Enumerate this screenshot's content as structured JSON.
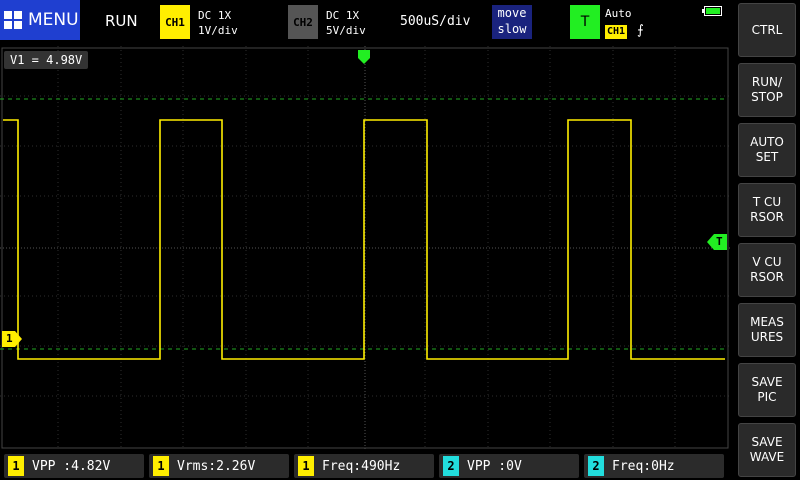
{
  "header": {
    "menu_label": "MENU",
    "run_state": "RUN",
    "ch1": {
      "label": "CH1",
      "coupling": "DC  1X",
      "scale": "1V/div"
    },
    "ch2": {
      "label": "CH2",
      "coupling": "DC  1X",
      "scale": "5V/div"
    },
    "timebase": "500uS/div",
    "move": {
      "line1": "move",
      "line2": "slow"
    },
    "trigger": {
      "label": "T",
      "mode": "Auto",
      "source": "CH1",
      "edge": "⨍"
    }
  },
  "readout": {
    "v1": "V1 = 4.98V"
  },
  "markers": {
    "ch1": "1",
    "trigger": "T"
  },
  "sidebar": {
    "buttons": [
      {
        "label": "CTRL"
      },
      {
        "label": "RUN/\nSTOP"
      },
      {
        "label": "AUTO\nSET"
      },
      {
        "label": "T CU\nRSOR"
      },
      {
        "label": "V CU\nRSOR"
      },
      {
        "label": "MEAS\nURES"
      },
      {
        "label": "SAVE\nPIC"
      },
      {
        "label": "SAVE\nWAVE"
      }
    ]
  },
  "measurements": [
    {
      "channel": "1",
      "text": "VPP :4.82V"
    },
    {
      "channel": "1",
      "text": "Vrms:2.26V"
    },
    {
      "channel": "1",
      "text": "Freq:490Hz"
    },
    {
      "channel": "2",
      "text": "VPP :0V"
    },
    {
      "channel": "2",
      "text": "Freq:0Hz"
    }
  ],
  "colors": {
    "ch1": "#ffee00",
    "ch2": "#22dddd",
    "trigger": "#22ee22",
    "menu": "#1f3fd0"
  }
}
